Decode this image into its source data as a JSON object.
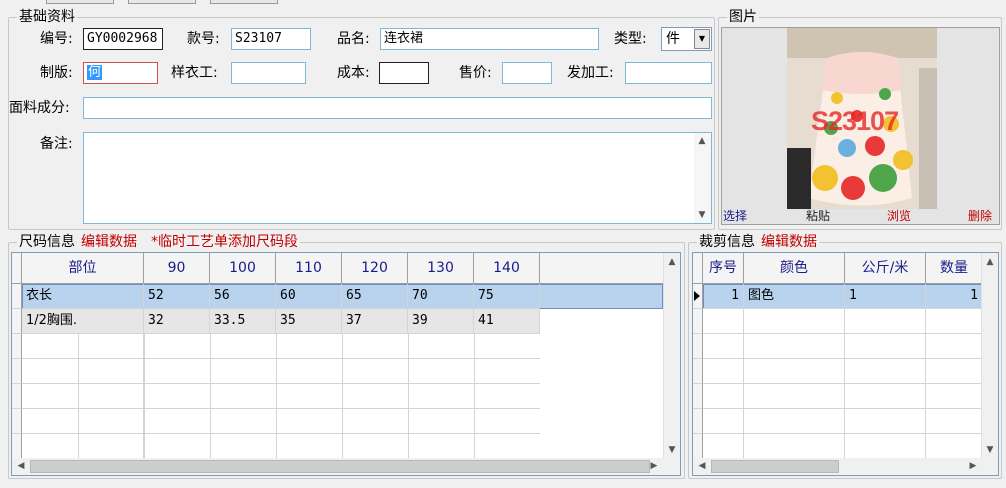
{
  "basic": {
    "title": "基础资料",
    "code_label": "编号:",
    "code_value": "GY0002968",
    "style_label": "款号:",
    "style_value": "S23107",
    "name_label": "品名:",
    "name_value": "连衣裙",
    "type_label": "类型:",
    "type_value": "件",
    "maker_label": "制版:",
    "maker_value": "何",
    "sample_label": "样衣工:",
    "sample_value": "",
    "cost_label": "成本:",
    "cost_value": "",
    "price_label": "售价:",
    "price_value": "",
    "process_label": "发加工:",
    "process_value": "",
    "fabric_label": "面料成分:",
    "fabric_value": "",
    "remark_label": "备注:",
    "remark_value": ""
  },
  "photo": {
    "title": "图片",
    "watermark": "S23107",
    "select": "选择",
    "paste": "粘贴",
    "browse": "浏览",
    "delete": "删除"
  },
  "size": {
    "title": "尺码信息",
    "edit": "编辑数据",
    "add": "*临时工艺单添加尺码段",
    "columns": [
      "部位",
      "90",
      "100",
      "110",
      "120",
      "130",
      "140"
    ],
    "rows": [
      [
        "衣长",
        "52",
        "56",
        "60",
        "65",
        "70",
        "75"
      ],
      [
        "1/2胸围.",
        "32",
        "33.5",
        "35",
        "37",
        "39",
        "41"
      ]
    ]
  },
  "cut": {
    "title": "裁剪信息",
    "edit": "编辑数据",
    "columns": [
      "序号",
      "颜色",
      "公斤/米",
      "数量"
    ],
    "rows": [
      [
        "1",
        "图色",
        "1",
        "1"
      ]
    ]
  },
  "colors": {
    "accent_red": "#c00000",
    "header_blue": "#1a1a8c",
    "selected_row": "#b9d3ee"
  }
}
